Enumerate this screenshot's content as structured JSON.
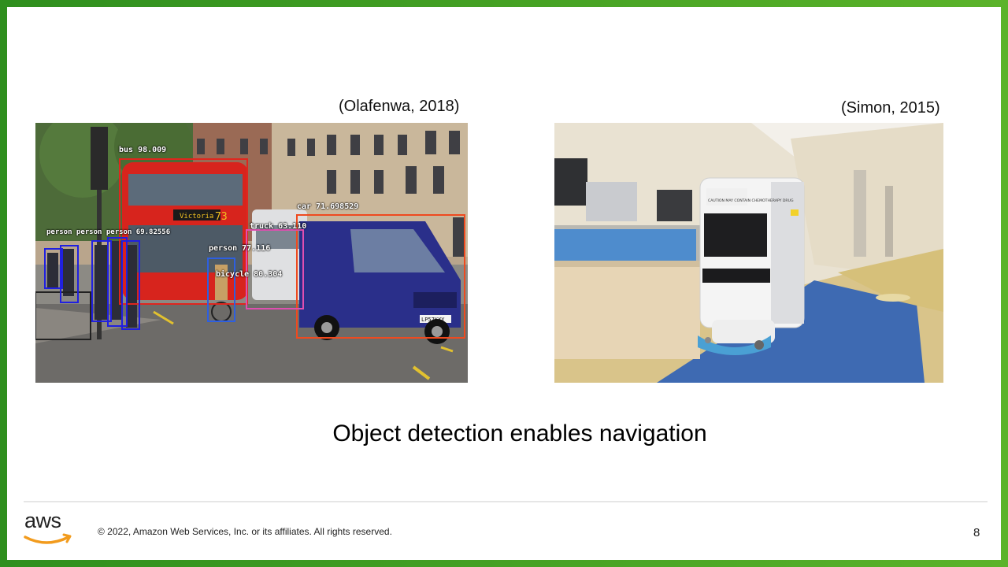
{
  "slide": {
    "left_caption": "(Olafenwa, 2018)",
    "right_caption": "(Simon, 2015)",
    "body_text": "Object detection enables navigation",
    "copyright": "© 2022, Amazon Web Services, Inc. or its affiliates. All rights reserved.",
    "page_number": "8",
    "logo_text": "aws"
  },
  "detections": {
    "bus": "bus 98.009",
    "car": "car 71.698529",
    "truck": "truck 63.110",
    "person_mid": "person 77.116",
    "bicycle": "bicycle 80.304",
    "persons_left": "person person person 69.82556",
    "bus_sign": "Victoria",
    "bus_number": "73",
    "plate": "LP57KXY"
  },
  "robot": {
    "warning_text": "CAUTION MAY CONTAIN CHEMOTHERAPY DRUG"
  },
  "colors": {
    "frame_green": "#3c9e22",
    "bus_red": "#d7241d",
    "van_blue": "#2a2f8a"
  }
}
